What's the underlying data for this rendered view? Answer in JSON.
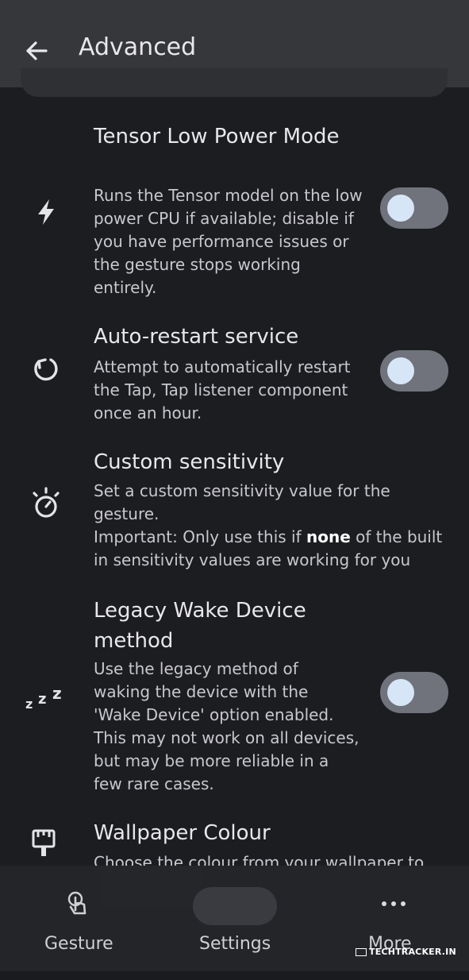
{
  "header": {
    "title": "Advanced",
    "back_icon": "arrow-left-icon"
  },
  "settings": [
    {
      "icon": "bolt-icon",
      "title": "Tensor Low Power Mode",
      "description": "Runs the Tensor model on the low power CPU if available; disable if you have performance issues or the gesture stops working entirely.",
      "toggle_on": false
    },
    {
      "icon": "restart-icon",
      "title": "Auto-restart service",
      "description": "Attempt to automatically restart the Tap, Tap listener component once an hour.",
      "toggle_on": false
    },
    {
      "icon": "stopwatch-icon",
      "title": "Custom sensitivity",
      "description_line1": "Set a custom sensitivity value for the gesture.",
      "description_prefix": "Important: Only use this if ",
      "description_bold": "none",
      "description_suffix": " of the built in sensitivity values are working for you"
    },
    {
      "icon": "sleep-zzz-icon",
      "title": "Legacy Wake Device method",
      "description": "Use the legacy method of waking the device with the 'Wake Device' option enabled. This may not work on all devices, but may be more reliable in a few rare cases.",
      "toggle_on": false
    },
    {
      "icon": "paint-brush-icon",
      "title": "Wallpaper Colour",
      "description": "Choose the colour from your wallpaper to use throughout Tap, Tap's UI"
    }
  ],
  "bottom_nav": [
    {
      "label": "Gesture",
      "icon": "touch-icon",
      "selected": false
    },
    {
      "label": "Settings",
      "icon": "tune-icon",
      "selected": true
    },
    {
      "label": "More",
      "icon": "more-horizontal-icon",
      "selected": false
    }
  ],
  "watermark": "TECHTRACKER.IN",
  "colors": {
    "background": "#1c1d21",
    "app_bar": "#36373b",
    "toggle_track": "#70737c",
    "toggle_knob": "#d6e6f7"
  }
}
